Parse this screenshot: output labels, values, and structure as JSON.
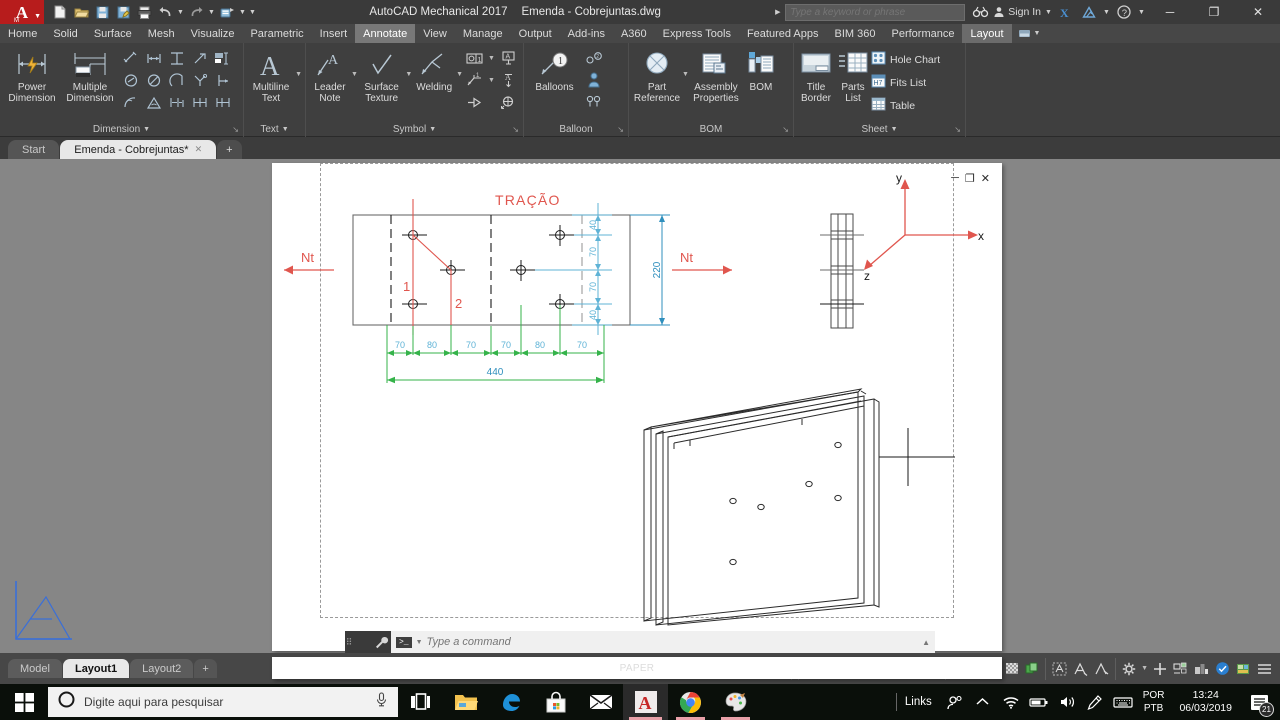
{
  "titlebar": {
    "app_icon": "autocad-a-icon",
    "app_name": "AutoCAD Mechanical 2017",
    "document_name": "Emenda - Cobrejuntas.dwg",
    "quick_access": [
      {
        "name": "new-icon",
        "label": "New"
      },
      {
        "name": "open-icon",
        "label": "Open"
      },
      {
        "name": "save-icon",
        "label": "Save"
      },
      {
        "name": "save-as-icon",
        "label": "Save As"
      },
      {
        "name": "plot-icon",
        "label": "Plot"
      },
      {
        "name": "undo-icon",
        "label": "Undo"
      },
      {
        "name": "redo-icon",
        "label": "Redo"
      },
      {
        "name": "share-icon",
        "label": "Share"
      },
      {
        "name": "customize-icon",
        "label": "Customize Quick Access Toolbar"
      }
    ],
    "search_placeholder": "Type a keyword or phrase",
    "search_value": "",
    "search_icon": "binoculars-icon",
    "sign_in": "Sign In",
    "exchange_icon": "autodesk-exchange-icon",
    "x_icon": "exchange-x-icon",
    "help_icon": "help-question-icon",
    "window_buttons": {
      "minimize": "─",
      "restore": "❐",
      "close": "✕"
    }
  },
  "ribbon_tabs": [
    {
      "label": "Home",
      "active": false
    },
    {
      "label": "Solid",
      "active": false
    },
    {
      "label": "Surface",
      "active": false
    },
    {
      "label": "Mesh",
      "active": false
    },
    {
      "label": "Visualize",
      "active": false
    },
    {
      "label": "Parametric",
      "active": false
    },
    {
      "label": "Insert",
      "active": false
    },
    {
      "label": "Annotate",
      "active": true
    },
    {
      "label": "View",
      "active": false
    },
    {
      "label": "Manage",
      "active": false
    },
    {
      "label": "Output",
      "active": false
    },
    {
      "label": "Add-ins",
      "active": false
    },
    {
      "label": "A360",
      "active": false
    },
    {
      "label": "Express Tools",
      "active": false
    },
    {
      "label": "Featured Apps",
      "active": false
    },
    {
      "label": "BIM 360",
      "active": false
    },
    {
      "label": "Performance",
      "active": false
    },
    {
      "label": "Layout",
      "active": true
    }
  ],
  "ribbon_panels": {
    "dimension": {
      "label": "Dimension",
      "big_buttons": [
        {
          "name": "power-dimension-button",
          "line1": "Power",
          "line2": "Dimension",
          "icon": "power-dimension-icon"
        },
        {
          "name": "multiple-dimension-button",
          "line1": "Multiple",
          "line2": "Dimension",
          "icon": "multiple-dimension-icon"
        }
      ],
      "small_icons": [
        "aligned-dim-icon",
        "linear-dim-icon",
        "baseline-dim-icon",
        "leader-dim-icon",
        "hole-dim-icon",
        "diameter-dim-icon",
        "diameter-slash-icon",
        "arc-dim-icon",
        "symmetric-dim-icon",
        "ordinate-dim-icon",
        "arc-length-icon",
        "angular-dim-icon",
        "chain-dim-icon",
        "stepped-dim-icon",
        "continue-dim-icon"
      ]
    },
    "text": {
      "label": "Text",
      "big_buttons": [
        {
          "name": "multiline-text-button",
          "line1": "Multiline",
          "line2": "Text",
          "icon": "multiline-text-icon"
        }
      ]
    },
    "symbol": {
      "label": "Symbol",
      "big_buttons": [
        {
          "name": "leader-note-button",
          "line1": "Leader",
          "line2": "Note",
          "icon": "leader-note-icon"
        },
        {
          "name": "surface-texture-button",
          "line1": "Surface",
          "line2": "Texture",
          "icon": "surface-texture-icon"
        },
        {
          "name": "welding-button",
          "line1": "Welding",
          "line2": "",
          "icon": "welding-icon"
        }
      ],
      "small_icons": [
        "feature-control-frame-icon",
        "datum-identifier-icon",
        "taper-slope-icon",
        "text-above-icon",
        "feature-symbol-icon",
        "edge-symbol-icon"
      ]
    },
    "balloon": {
      "label": "Balloon",
      "big_buttons": [
        {
          "name": "balloons-button",
          "line1": "Balloons",
          "line2": "",
          "icon": "balloon-icon"
        }
      ],
      "small_icons": [
        "auto-balloon-icon",
        "collect-balloon-icon",
        "renumber-balloon-icon"
      ]
    },
    "bom": {
      "label": "BOM",
      "big_buttons": [
        {
          "name": "part-reference-button",
          "line1": "Part",
          "line2": "Reference",
          "icon": "part-reference-icon"
        },
        {
          "name": "assembly-properties-button",
          "line1": "Assembly",
          "line2": "Properties",
          "icon": "assembly-properties-icon"
        },
        {
          "name": "bom-button",
          "line1": "BOM",
          "line2": "",
          "icon": "bom-icon"
        }
      ]
    },
    "sheet": {
      "label": "Sheet",
      "big_buttons": [
        {
          "name": "title-border-button",
          "line1": "Title",
          "line2": "Border",
          "icon": "title-border-icon"
        },
        {
          "name": "parts-list-button",
          "line1": "Parts",
          "line2": "List",
          "icon": "parts-list-icon"
        }
      ],
      "list_items": [
        {
          "name": "hole-chart-button",
          "label": "Hole Chart",
          "icon": "hole-chart-icon"
        },
        {
          "name": "fits-list-button",
          "label": "Fits List",
          "icon": "fits-list-icon"
        },
        {
          "name": "table-button",
          "label": "Table",
          "icon": "table-icon"
        }
      ]
    }
  },
  "file_tabs": [
    {
      "label": "Start",
      "active": false,
      "closable": false
    },
    {
      "label": "Emenda - Cobrejuntas*",
      "active": true,
      "closable": true
    },
    {
      "label": "+",
      "active": false,
      "closable": false
    }
  ],
  "drawing": {
    "title_label": "TRAÇÃO",
    "force_left_label": "Nt",
    "force_right_label": "Nt",
    "callout_1": "1",
    "callout_2": "2",
    "horizontal_dims": [
      "70",
      "80",
      "70",
      "70",
      "80",
      "70"
    ],
    "overall_width": "440",
    "vertical_dims": [
      "40",
      "70",
      "70",
      "40"
    ],
    "overall_height": "220",
    "axis_labels": {
      "x": "x",
      "y": "y",
      "z": "z"
    },
    "colors": {
      "red": "#e0564e",
      "blue": "#2f8fbd",
      "green": "#35b34a",
      "light_blue": "#5fb3d6",
      "outline": "#6b6b6b",
      "paper": "#ffffff",
      "canvas": "#868686"
    },
    "viewport_controls": {
      "minimize": "─",
      "restore": "❐",
      "close": "✕"
    },
    "nav_bar_icons": [
      "close-nav-icon",
      "steering-wheel-icon",
      "pan-hand-icon",
      "zoom-extents-icon",
      "nav-more-icon",
      "nav-options-icon"
    ]
  },
  "command_line": {
    "placeholder": "Type a command",
    "value": "",
    "close_icon": "close-icon",
    "settings_icon": "wrench-icon",
    "prompt_icon": "command-prompt-icon",
    "expand_icon": "chevron-up-icon"
  },
  "status_bar": {
    "layout_tabs": [
      {
        "label": "Model",
        "active": false
      },
      {
        "label": "Layout1",
        "active": true
      },
      {
        "label": "Layout2",
        "active": false
      },
      {
        "label": "+",
        "active": false
      }
    ],
    "space_mode": "PAPER",
    "tool_icons": [
      {
        "name": "snap-mode-icon"
      },
      {
        "name": "grid-display-icon"
      },
      {
        "name": "ortho-mode-icon"
      },
      {
        "name": "polar-tracking-icon"
      },
      {
        "name": "object-snap-icon"
      },
      {
        "name": "object-snap-tracking-icon"
      },
      {
        "name": "dynamic-ucs-icon"
      },
      {
        "name": "lineweight-icon"
      },
      {
        "name": "transparency-icon"
      },
      {
        "name": "selection-cycling-icon"
      },
      {
        "name": "annotation-visibility-icon"
      },
      {
        "name": "auto-scale-icon"
      },
      {
        "name": "annotation-scale-icon"
      },
      {
        "name": "workspace-gear-icon"
      },
      {
        "name": "add-tool-icon"
      },
      {
        "name": "isolate-objects-icon"
      },
      {
        "name": "hardware-accel-icon"
      },
      {
        "name": "clean-screen-icon"
      },
      {
        "name": "customization-icon"
      }
    ]
  },
  "taskbar": {
    "start_icon": "windows-start-icon",
    "search_icon": "cortana-circle-icon",
    "search_placeholder": "Digite aqui para pesquisar",
    "mic_icon": "microphone-icon",
    "task_view_icon": "task-view-icon",
    "apps": [
      {
        "name": "file-explorer-icon",
        "active": false
      },
      {
        "name": "edge-browser-icon",
        "active": false
      },
      {
        "name": "microsoft-store-icon",
        "active": false
      },
      {
        "name": "mail-icon",
        "active": false
      },
      {
        "name": "autocad-icon",
        "active": true
      },
      {
        "name": "chrome-icon",
        "active": false
      },
      {
        "name": "paint-icon",
        "active": false
      }
    ],
    "tray": {
      "links_label": "Links",
      "icons": [
        "people-icon",
        "show-hidden-icons-icon",
        "wifi-icon",
        "battery-icon",
        "volume-icon",
        "pen-icon",
        "keyboard-icon"
      ],
      "language_line1": "POR",
      "language_line2": "PTB",
      "time": "13:24",
      "date": "06/03/2019",
      "notification_count": "21",
      "notification_icon": "action-center-icon"
    }
  }
}
